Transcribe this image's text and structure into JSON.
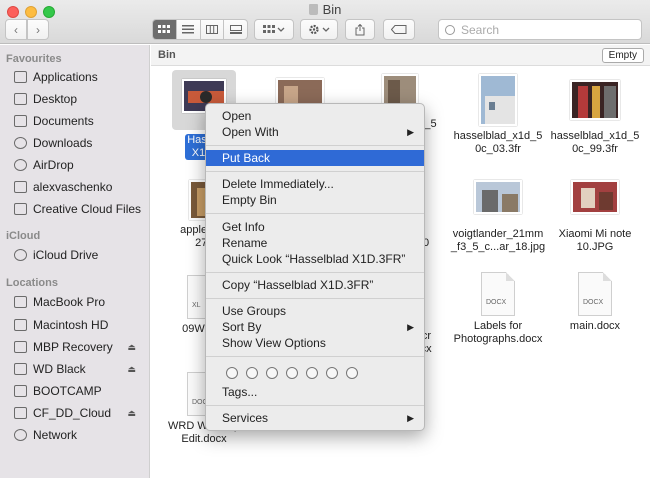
{
  "window": {
    "title": "Bin"
  },
  "toolbar": {
    "back_icon": "chevron-left-icon",
    "forward_icon": "chevron-right-icon",
    "search_placeholder": "Search"
  },
  "sidebar": {
    "sections": [
      {
        "heading": "Favourites",
        "items": [
          "Applications",
          "Desktop",
          "Documents",
          "Downloads",
          "AirDrop",
          "alexvaschenko",
          "Creative Cloud Files"
        ]
      },
      {
        "heading": "iCloud",
        "items": [
          "iCloud Drive"
        ]
      },
      {
        "heading": "Locations",
        "items": [
          "MacBook Pro",
          "Macintosh HD",
          "MBP Recovery",
          "WD Black",
          "BOOTCAMP",
          "CF_DD_Cloud",
          "Network"
        ]
      }
    ]
  },
  "pathbar": {
    "location": "Bin",
    "empty_label": "Empty"
  },
  "files": {
    "f1": {
      "line1": "Hassel",
      "line2": "X1D."
    },
    "f2": {
      "line1": "d_5",
      "line2": ""
    },
    "f3": {
      "line1": "hasselblad_x1d_5",
      "line2": "0c_03.3fr"
    },
    "f4": {
      "line1": "hasselblad_x1d_5",
      "line2": "0c_99.3fr"
    },
    "f5": {
      "line1": "apple_iph",
      "line2": "27.j"
    },
    "f6": {
      "line1": "000",
      "line2": ""
    },
    "f7": {
      "line1": "voigtlander_21mm",
      "line2": "_f3_5_c...ar_18.jpg"
    },
    "f8": {
      "line1": "Xiaomi Mi note",
      "line2": "10.JPG"
    },
    "f9": {
      "line1": "09Workb",
      "line2": ""
    },
    "f10": {
      "line1": "vScr",
      "line2": "docx"
    },
    "f11": {
      "line1": "Labels for",
      "line2": "Photographs.docx"
    },
    "f12": {
      "line1": "main.docx",
      "line2": ""
    },
    "f13": {
      "line1": "WRD Write Up",
      "line2": "Edit.docx"
    },
    "doc_tag": "DOCX",
    "xlsx_tag": "XL"
  },
  "context_menu": {
    "open": "Open",
    "open_with": "Open With",
    "put_back": "Put Back",
    "delete_immediately": "Delete Immediately...",
    "empty_bin": "Empty Bin",
    "get_info": "Get Info",
    "rename": "Rename",
    "quick_look": "Quick Look “Hasselblad X1D.3FR”",
    "copy": "Copy “Hasselblad X1D.3FR”",
    "use_groups": "Use Groups",
    "sort_by": "Sort By",
    "show_view_options": "Show View Options",
    "tags": "Tags...",
    "services": "Services",
    "submenu_arrow": "▶",
    "highlight_color": "#2f6ad6"
  }
}
